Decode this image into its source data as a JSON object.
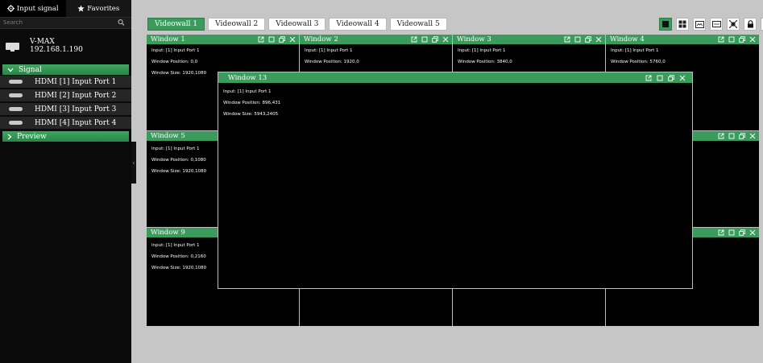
{
  "sidebar": {
    "tabs": [
      {
        "label": "Input signal",
        "icon": "gear-icon"
      },
      {
        "label": "Favorites",
        "icon": "star-icon"
      }
    ],
    "search": {
      "placeholder": "Search"
    },
    "device": {
      "name": "V-MAX",
      "ip": "192.168.1.190"
    },
    "signal_section": "Signal",
    "signals": [
      "HDMI [1] Input Port 1",
      "HDMI [2] Input Port 2",
      "HDMI [3] Input Port 3",
      "HDMI [4] Input Port 4"
    ],
    "preview_section": "Preview",
    "collapse_glyph": "‹"
  },
  "tabs": [
    {
      "label": "Videowall 1",
      "active": true
    },
    {
      "label": "Videowall 2",
      "active": false
    },
    {
      "label": "Videowall 3",
      "active": false
    },
    {
      "label": "Videowall 4",
      "active": false
    },
    {
      "label": "Videowall 5",
      "active": false
    }
  ],
  "toolbar": [
    {
      "icon": "single-screen-icon",
      "active": true
    },
    {
      "icon": "grid-layout-icon",
      "active": false
    },
    {
      "icon": "scene-icon",
      "active": false
    },
    {
      "icon": "display-icon",
      "active": false
    },
    {
      "icon": "fit-screen-icon",
      "active": false
    },
    {
      "icon": "lock-icon",
      "active": false
    },
    {
      "icon": "clear-icon",
      "active": false
    }
  ],
  "window_labels": {
    "input": "Input: ",
    "position": "Window Position: ",
    "size": "Window Size: "
  },
  "windows": [
    {
      "id": "window-1",
      "title": "Window 1",
      "input": "[1] Input Port 1",
      "position": "0,0",
      "size": "1920,1080"
    },
    {
      "id": "window-2",
      "title": "Window 2",
      "input": "[1] Input Port 1",
      "position": "1920,0"
    },
    {
      "id": "window-3",
      "title": "Window 3",
      "input": "[1] Input Port 1",
      "position": "3840,0"
    },
    {
      "id": "window-4",
      "title": "Window 4",
      "input": "[1] Input Port 1",
      "position": "5760,0"
    },
    {
      "id": "window-5",
      "title": "Window 5",
      "input": "[1] Input Port 1",
      "position": "0,1080",
      "size": "1920,1080"
    },
    {
      "id": "window-8",
      "title": "",
      "input": "",
      "position": ""
    },
    {
      "id": "window-9",
      "title": "Window 9",
      "input": "[1] Input Port 1",
      "position": "0,2160",
      "size": "1920,1080"
    },
    {
      "id": "window-12",
      "title": "",
      "input": "",
      "position": ""
    },
    {
      "id": "window-13",
      "title": "Window 13",
      "input": "[1] Input Port 1",
      "position": "896,431",
      "size": "5943,2405"
    }
  ]
}
